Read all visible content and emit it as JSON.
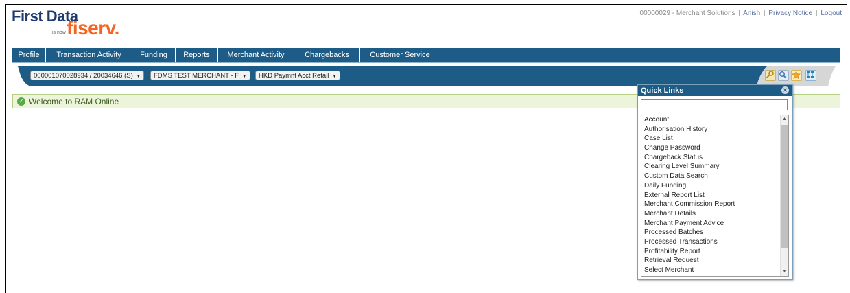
{
  "header": {
    "logo_primary": "First Data",
    "logo_isnow": "is now",
    "logo_secondary": "fiserv.",
    "account_text": "00000029 - Merchant Solutions",
    "user_link": "Anish",
    "privacy_link": "Privacy Notice",
    "logout_link": "Logout",
    "separator": "|"
  },
  "nav": {
    "tabs": [
      {
        "label": "Profile"
      },
      {
        "label": "Transaction Activity"
      },
      {
        "label": "Funding"
      },
      {
        "label": "Reports"
      },
      {
        "label": "Merchant Activity"
      },
      {
        "label": "Chargebacks"
      },
      {
        "label": "Customer Service"
      }
    ]
  },
  "filters": {
    "account_select": "000001070028934 / 20034646 (S)",
    "merchant_select": "FDMS TEST MERCHANT - F",
    "acct_type_select": "HKD Paymnt Acct Retail",
    "arrow": "▼"
  },
  "toolbar": {
    "icons": [
      "key-search-icon",
      "magnifier-icon",
      "star-icon",
      "sitemap-icon"
    ]
  },
  "welcome": {
    "message": "Welcome to RAM Online"
  },
  "quick_links": {
    "title": "Quick Links",
    "search_value": "",
    "items": [
      "Account",
      "Authorisation History",
      "Case List",
      "Change Password",
      "Chargeback Status",
      "Clearing Level Summary",
      "Custom Data Search",
      "Daily Funding",
      "External Report List",
      "Merchant Commission Report",
      "Merchant Details",
      "Merchant Payment Advice",
      "Processed Batches",
      "Processed Transactions",
      "Profitability Report",
      "Retrieval Request",
      "Select Merchant"
    ]
  },
  "colors": {
    "nav_bg": "#1c5c86",
    "brand_blue": "#1f3b6e",
    "brand_orange": "#f26522",
    "welcome_bg": "#ecf4d9"
  }
}
